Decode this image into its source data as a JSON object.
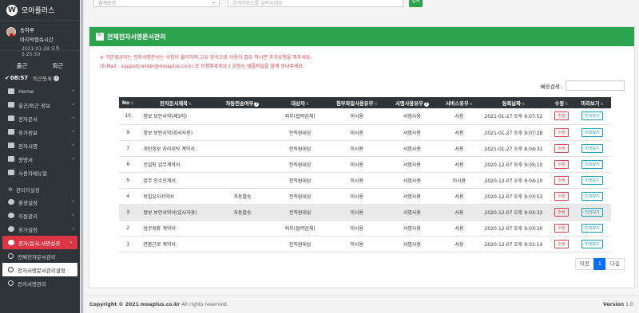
{
  "brand": {
    "name": "모아플러스",
    "logo_letter": "W"
  },
  "user": {
    "name": "송하루",
    "last_login_label": "마지막접속시간",
    "last_login_time": "2021-01-28 오후 5:25:50"
  },
  "attendance": {
    "checkin": "출근",
    "checkout": "퇴근",
    "time": "08:57",
    "checkout_reg": "퇴근등록"
  },
  "nav": {
    "home": "Home",
    "attendance_info": "출근/퇴근 정보",
    "e_doc": "전자문서",
    "vacation": "휴가정보",
    "e_sign": "전자서명",
    "certificate": "증명서",
    "user_manual": "사용자메뉴얼",
    "admin_section": "관리자설정",
    "env_settings": "환경설정",
    "staff_mgmt": "직원관리",
    "vacation_settings": "휴가설정",
    "doc_sign_settings": "전자/문서,서명설정",
    "all_doc_mgmt": "전체전자문서관리",
    "sign_doc_settings": "전자서명문서관리설정",
    "sign_mgmt": "전자서명관리"
  },
  "search": {
    "condition_placeholder": "검색조건",
    "keyword_placeholder": "검색키워드를 입력하세요",
    "button": "검색"
  },
  "panel": {
    "title": "전체전자서명문서관리",
    "notice_1": "※ 기본제공되는 전자서명문서는 수정이 불가하며,고유 양식으로 사용이 필요 하시면 추가요청을 해주세요.",
    "notice_2": "(E-Mail : supportcenter@moaplus.co.kr 로 요청해주세요.) 요청시 샘플파일을 함께 보내주세요.",
    "quick_search_label": "빠른검색 :"
  },
  "table": {
    "headers": [
      "No",
      "전자문서제목",
      "자동전송여부",
      "대상자",
      "첨부파일사용유무",
      "서명사용유무",
      "서버스유무",
      "등록날짜",
      "수정",
      "미리보기"
    ],
    "edit_label": "수정",
    "preview_label": "미리보기",
    "rows": [
      {
        "no": "10",
        "title": "정보 보안서약(제3자)",
        "auto": "",
        "target": "외부(협력업체)",
        "attach": "미사용",
        "sign": "서명사용",
        "service": "사용",
        "date": "2021-01-27 오후 9:07:52"
      },
      {
        "no": "9",
        "title": "정보 보안서약(회사자용)",
        "auto": "",
        "target": "전직원대상",
        "attach": "미사용",
        "sign": "서명사용",
        "service": "사용",
        "date": "2021-01-27 오후 9:07:28"
      },
      {
        "no": "7",
        "title": "개인정보 처리위탁 계약서",
        "auto": "",
        "target": "전직원대상",
        "attach": "미사용",
        "sign": "서명사용",
        "service": "사용",
        "date": "2021-01-27 오후 8:04:31"
      },
      {
        "no": "6",
        "title": "컨설팅 업무계약서",
        "auto": "",
        "target": "전직원대상",
        "attach": "미사용",
        "sign": "서명사용",
        "service": "사용",
        "date": "2020-12-07 오후 9:05:10"
      },
      {
        "no": "5",
        "title": "업무 인수인계서",
        "auto": "",
        "target": "전직원대상",
        "attach": "미사용",
        "sign": "서명사용",
        "service": "미사용",
        "date": "2020-12-07 오후 9:04:10"
      },
      {
        "no": "4",
        "title": "비밀유지서약서",
        "auto": "자동발송",
        "target": "전직원대상",
        "attach": "미사용",
        "sign": "서명사용",
        "service": "사용",
        "date": "2020-12-07 오후 9:03:53"
      },
      {
        "no": "3",
        "title": "정보 보안서약서(입사자용)",
        "auto": "자동발송",
        "target": "전직원대상",
        "attach": "미사용",
        "sign": "서명사용",
        "service": "사용",
        "date": "2020-12-07 오후 9:03:32"
      },
      {
        "no": "2",
        "title": "업무제휴 계약서",
        "auto": "",
        "target": "외부(협력업체)",
        "attach": "미사용",
        "sign": "서명사용",
        "service": "사용",
        "date": "2020-12-07 오후 9:03:20"
      },
      {
        "no": "1",
        "title": "연봉근로 계약서",
        "auto": "",
        "target": "전직원대상",
        "attach": "미사용",
        "sign": "서명사용",
        "service": "사용",
        "date": "2020-12-07 오후 9:02:14"
      }
    ]
  },
  "pager": {
    "prev": "이전",
    "current": "1",
    "next": "다음"
  },
  "footer": {
    "copyright_prefix": "Copyright © 2021",
    "site": "moaplus.co.kr",
    "rights": "All rights reserved.",
    "version_label": "Version",
    "version": "1.0"
  },
  "colors": {
    "sidebar": "#2f3439",
    "accent_green": "#2ea34f",
    "active_red": "#dc3545",
    "notice_red": "#e0464e",
    "preview_teal": "#17a2b8",
    "pager_blue": "#0d6efd"
  }
}
